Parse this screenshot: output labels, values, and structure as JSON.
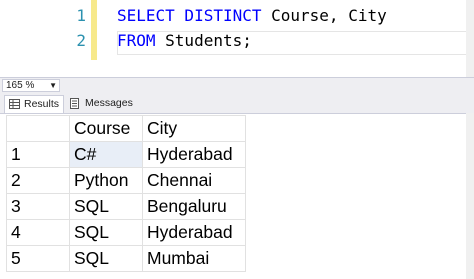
{
  "editor": {
    "lines": [
      {
        "num": "1",
        "kw1": "SELECT DISTINCT",
        "rest": " Course, City"
      },
      {
        "num": "2",
        "kw1": "FROM",
        "rest": " Students;"
      }
    ]
  },
  "zoom": {
    "value": "165 %"
  },
  "tabs": {
    "results": "Results",
    "messages": "Messages"
  },
  "grid": {
    "headers": [
      "Course",
      "City"
    ],
    "rows": [
      {
        "n": "1",
        "course": "C#",
        "city": "Hyderabad"
      },
      {
        "n": "2",
        "course": "Python",
        "city": "Chennai"
      },
      {
        "n": "3",
        "course": "SQL",
        "city": "Bengaluru"
      },
      {
        "n": "4",
        "course": "SQL",
        "city": "Hyderabad"
      },
      {
        "n": "5",
        "course": "SQL",
        "city": "Mumbai"
      }
    ]
  },
  "colors": {
    "keyword": "#0000ff",
    "line_number": "#2b91af",
    "change_bar": "#f7e98b"
  }
}
